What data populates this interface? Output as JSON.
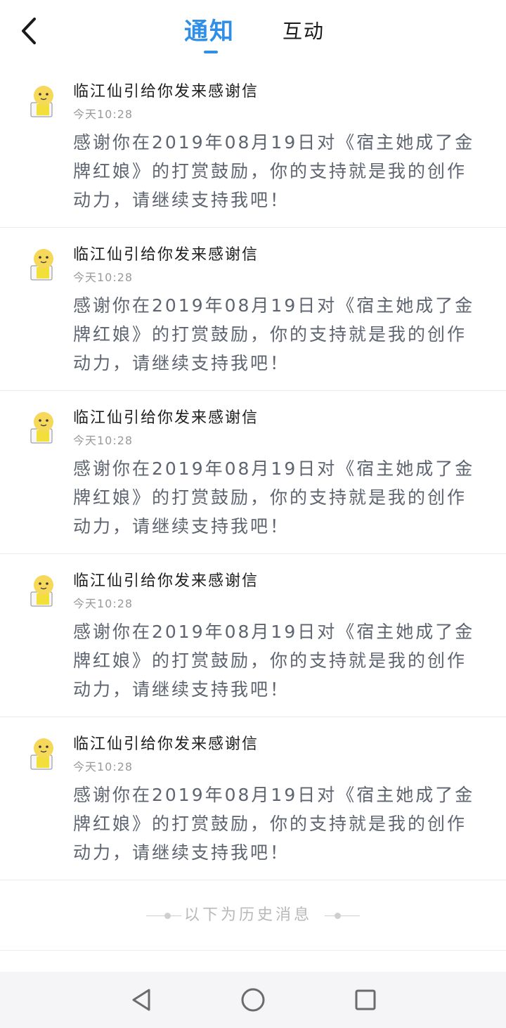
{
  "header": {
    "tabs": [
      {
        "label": "通知",
        "active": true
      },
      {
        "label": "互动",
        "active": false
      }
    ],
    "accent_color": "#2f8fe6"
  },
  "notifications": [
    {
      "title": "临江仙引给你发来感谢信",
      "time": "今天10:28",
      "body": "感谢你在2019年08月19日对《宿主她成了金牌红娘》的打赏鼓励，你的支持就是我的创作动力，请继续支持我吧！"
    },
    {
      "title": "临江仙引给你发来感谢信",
      "time": "今天10:28",
      "body": "感谢你在2019年08月19日对《宿主她成了金牌红娘》的打赏鼓励，你的支持就是我的创作动力，请继续支持我吧！"
    },
    {
      "title": "临江仙引给你发来感谢信",
      "time": "今天10:28",
      "body": "感谢你在2019年08月19日对《宿主她成了金牌红娘》的打赏鼓励，你的支持就是我的创作动力，请继续支持我吧！"
    },
    {
      "title": "临江仙引给你发来感谢信",
      "time": "今天10:28",
      "body": "感谢你在2019年08月19日对《宿主她成了金牌红娘》的打赏鼓励，你的支持就是我的创作动力，请继续支持我吧！"
    },
    {
      "title": "临江仙引给你发来感谢信",
      "time": "今天10:28",
      "body": "感谢你在2019年08月19日对《宿主她成了金牌红娘》的打赏鼓励，你的支持就是我的创作动力，请继续支持我吧！"
    }
  ],
  "history_divider": "以下为历史消息",
  "icons": {
    "back": "chevron-left-icon",
    "avatar": "lucky-cat-icon",
    "nav_back": "triangle-back-icon",
    "nav_home": "circle-home-icon",
    "nav_recent": "square-recent-icon"
  }
}
